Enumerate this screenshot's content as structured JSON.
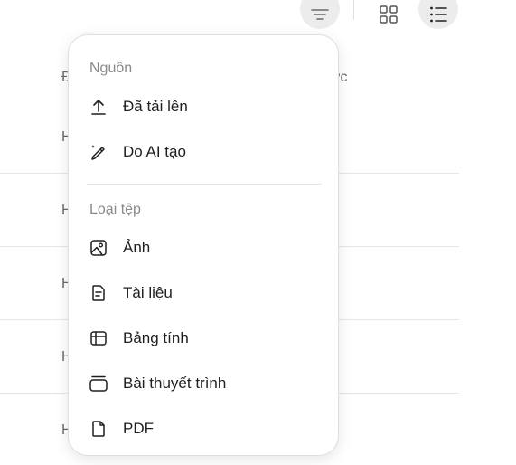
{
  "table": {
    "header_left": "Đ",
    "header_right": "ớc",
    "rows": [
      "H",
      "H",
      "H",
      "H",
      "H"
    ]
  },
  "toolbar": {
    "filter_icon": "filter-icon",
    "grid_icon": "grid-view-icon",
    "list_icon": "list-view-icon"
  },
  "menu": {
    "source_label": "Nguồn",
    "source_items": [
      {
        "label": "Đã tải lên",
        "icon": "upload-icon"
      },
      {
        "label": "Do AI tạo",
        "icon": "magic-pen-icon"
      }
    ],
    "filetype_label": "Loại tệp",
    "filetype_items": [
      {
        "label": "Ảnh",
        "icon": "image-icon"
      },
      {
        "label": "Tài liệu",
        "icon": "document-icon"
      },
      {
        "label": "Bảng tính",
        "icon": "spreadsheet-icon"
      },
      {
        "label": "Bài thuyết trình",
        "icon": "presentation-icon"
      },
      {
        "label": "PDF",
        "icon": "pdf-file-icon"
      }
    ]
  },
  "colors": {
    "accent_bg": "#ececec",
    "muted_text": "#8a8a8a",
    "text": "#1f1f1f"
  }
}
